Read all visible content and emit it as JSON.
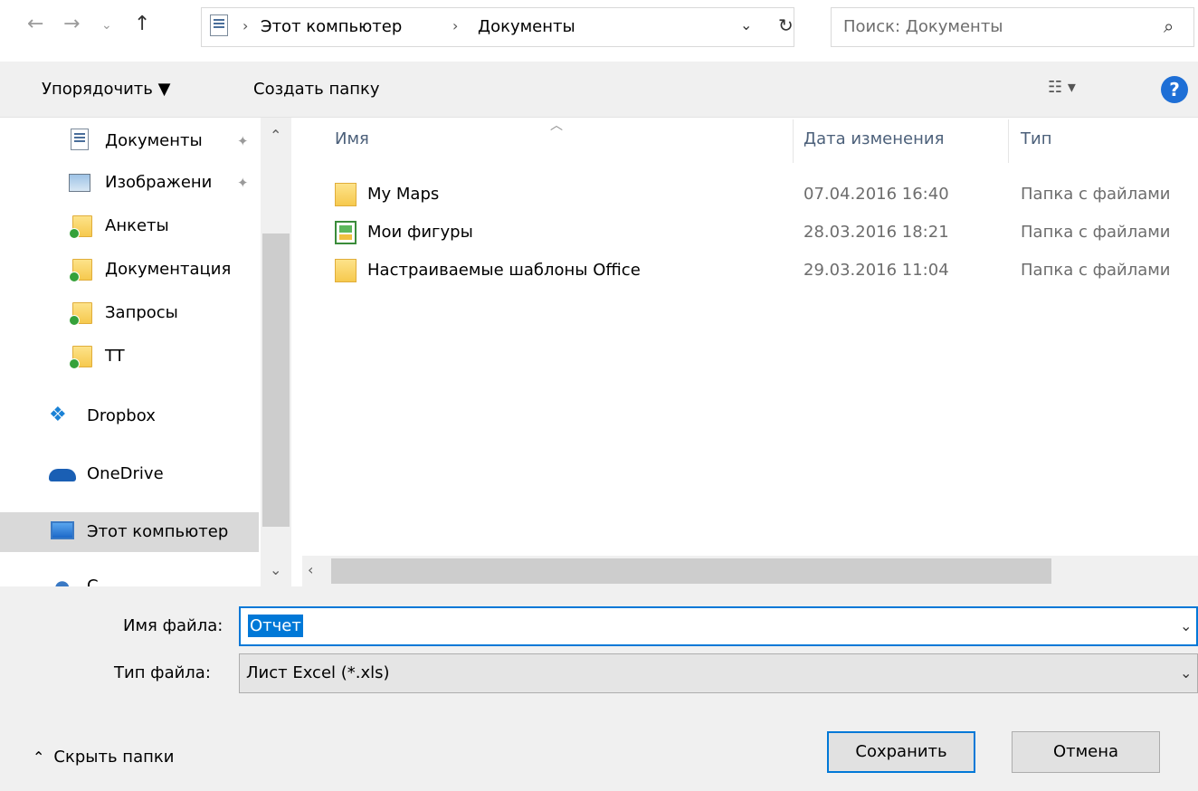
{
  "address_bar": {
    "breadcrumbs": [
      "Этот компьютер",
      "Документы"
    ],
    "search_placeholder": "Поиск: Документы"
  },
  "toolbar": {
    "organize_label": "Упорядочить ▼",
    "new_folder_label": "Создать папку",
    "help_label": "?"
  },
  "sidebar": {
    "items": [
      {
        "label": "Документы",
        "icon": "documents-icon",
        "pinned": true
      },
      {
        "label": "Изображени",
        "icon": "pictures-icon",
        "pinned": true
      },
      {
        "label": "Анкеты",
        "icon": "synced-folder-icon"
      },
      {
        "label": "Документация",
        "icon": "synced-folder-icon"
      },
      {
        "label": "Запросы",
        "icon": "synced-folder-icon"
      },
      {
        "label": "TT",
        "icon": "synced-folder-icon"
      },
      {
        "label": "Dropbox",
        "icon": "dropbox-icon"
      },
      {
        "label": "OneDrive",
        "icon": "onedrive-icon"
      },
      {
        "label": "Этот компьютер",
        "icon": "computer-icon",
        "selected": true
      },
      {
        "label": "С",
        "icon": "network-icon"
      }
    ]
  },
  "file_list": {
    "columns": [
      "Имя",
      "Дата изменения",
      "Тип"
    ],
    "rows": [
      {
        "name": "My Maps",
        "date": "07.04.2016 16:40",
        "type": "Папка с файлами",
        "icon": "folder-icon"
      },
      {
        "name": "Мои фигуры",
        "date": "28.03.2016 18:21",
        "type": "Папка с файлами",
        "icon": "shapes-folder-icon"
      },
      {
        "name": "Настраиваемые шаблоны Office",
        "date": "29.03.2016 11:04",
        "type": "Папка с файлами",
        "icon": "folder-icon"
      }
    ]
  },
  "form": {
    "filename_label": "Имя файла:",
    "filename_value": "Отчет",
    "filetype_label": "Тип файла:",
    "filetype_value": "Лист Excel (*.xls)"
  },
  "buttons": {
    "save": "Сохранить",
    "cancel": "Отмена",
    "hide_folders": "Скрыть папки"
  },
  "colors": {
    "accent": "#0078d7",
    "selection_bg": "#d9d9d9",
    "panel_bg": "#f0f0f0"
  }
}
